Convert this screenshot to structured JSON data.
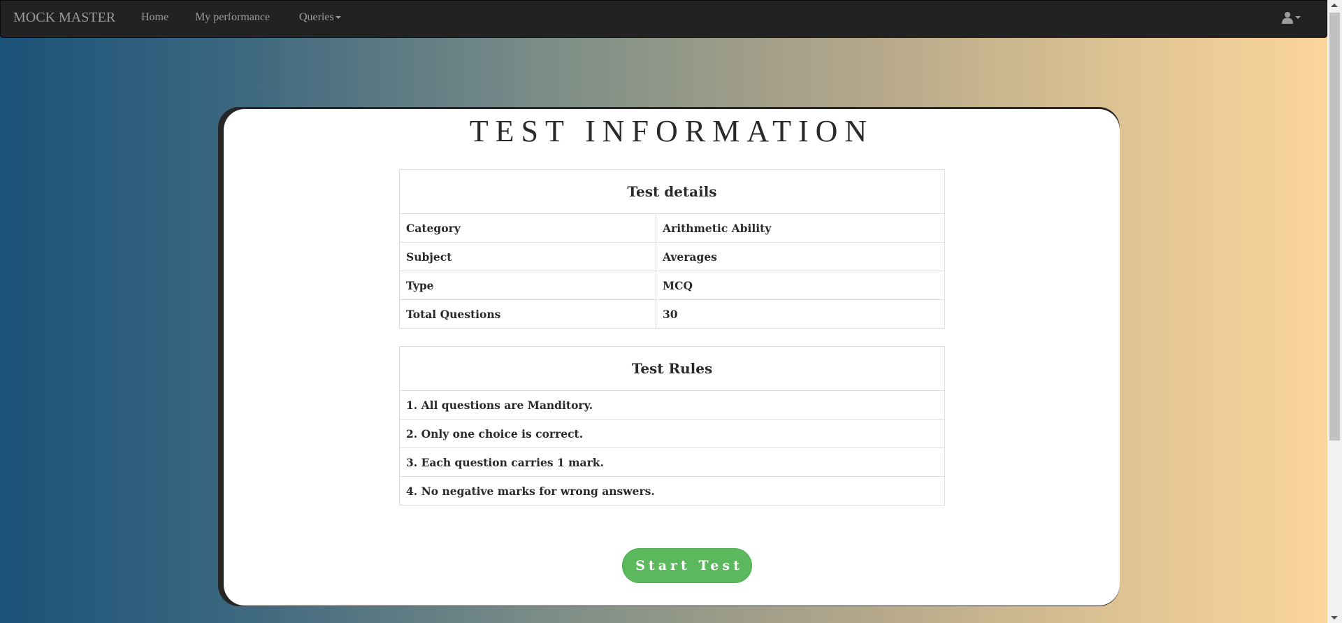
{
  "navbar": {
    "brand": "MOCK MASTER",
    "links": [
      "Home",
      "My performance",
      "Queries"
    ],
    "user_icon": "user-icon"
  },
  "card": {
    "title": "TEST INFORMATION",
    "details": {
      "heading": "Test details",
      "rows": [
        {
          "label": "Category",
          "value": "Arithmetic Ability"
        },
        {
          "label": "Subject",
          "value": "Averages"
        },
        {
          "label": "Type",
          "value": "MCQ"
        },
        {
          "label": "Total Questions",
          "value": "30"
        }
      ]
    },
    "rules": {
      "heading": "Test Rules",
      "items": [
        "1. All questions are Manditory.",
        "2. Only one choice is correct.",
        "3. Each question carries 1 mark.",
        "4. No negative marks for wrong answers."
      ]
    },
    "start_button": "Start Test"
  },
  "colors": {
    "navbar_bg": "#222222",
    "button_green": "#5cb85c",
    "gradient_left": "#1b5278",
    "gradient_right": "#fdd69c"
  }
}
